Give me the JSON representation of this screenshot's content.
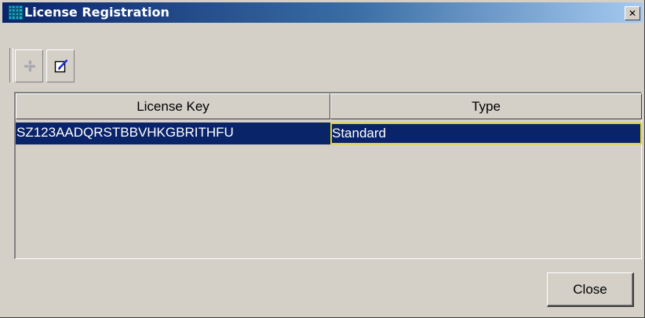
{
  "window": {
    "title": "License Registration",
    "close_glyph": "✕"
  },
  "toolbar": {
    "buttons": [
      {
        "name": "add-icon",
        "enabled": false
      },
      {
        "name": "edit-icon",
        "enabled": true
      }
    ]
  },
  "table": {
    "columns": [
      "License Key",
      "Type"
    ],
    "rows": [
      {
        "license_key": "SZ123AADQRSTBBVHKGBRITHFU",
        "type": "Standard",
        "selected": true
      }
    ]
  },
  "footer": {
    "close_label": "Close"
  },
  "colors": {
    "window_bg": "#d4d0c8",
    "selection_bg": "#0a246a",
    "focus_border": "#e5d80f",
    "title_gradient_start": "#0a246a",
    "title_gradient_end": "#a6caf0"
  }
}
